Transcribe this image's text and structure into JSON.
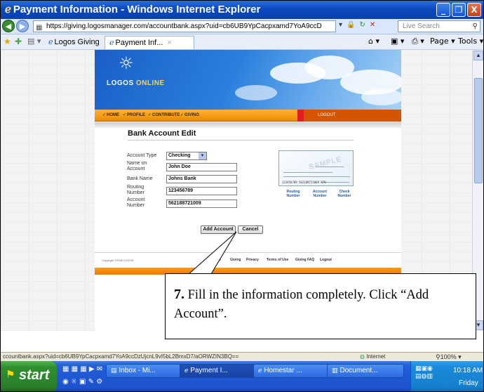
{
  "window": {
    "title": "Payment Information - Windows Internet Explorer",
    "minimize_glyph": "_",
    "restore_glyph": "❐",
    "close_glyph": "X"
  },
  "address_bar": {
    "url": "https://giving.logosmanager.com/accountbank.aspx?uid=cb6UB9YpCacpxamd7YoA9ccD",
    "search_placeholder": "Live Search"
  },
  "tabs": {
    "favorites_group_label": "Logos Giving",
    "active_tab_label": "Payment Inf...",
    "commands": [
      "Page ▾",
      "Tools ▾"
    ]
  },
  "site": {
    "logo_word": "LOGOS",
    "logo_online": "ONLINE",
    "menu": [
      "HOME",
      "PROFILE",
      "CONTRIBUTE",
      "GIVING"
    ],
    "logout_label": "LOGOUT",
    "section_title": "Bank Account Edit",
    "form": {
      "account_type_label": "Account Type",
      "account_type_value": "Checking",
      "name_label": "Name on Account",
      "name_value": "John Doe",
      "bank_label": "Bank Name",
      "bank_value": "Johns Bank",
      "routing_label": "Routing Number",
      "routing_value": "123456789",
      "account_label": "Account Number",
      "account_value": "562188721009"
    },
    "check_sample": {
      "watermark": "SAMPLE",
      "micr": "123456789  562188721009  678",
      "labels": [
        "Routing Number",
        "Account Number",
        "Check Number"
      ]
    },
    "buttons": {
      "add_account": "Add Account",
      "cancel": "Cancel"
    },
    "footer": {
      "copyright": "Copyright ©2006 LOGOS",
      "links": [
        "ribute",
        "Giving",
        "Privacy",
        "Terms of Use",
        "Giving FAQ",
        "Logout"
      ]
    }
  },
  "callout": {
    "step_number": "7.",
    "text": "Fill in the information completely.  Click “Add Account”."
  },
  "status_bar": {
    "url": "ccountbank.aspx?uid=cb6UB9YpCacpxamd7YoA9ccDzUjcnL9vI5bL2BmxD7/aORWZIN3BQ==",
    "zone": "Internet",
    "zoom": "100%"
  },
  "taskbar": {
    "start_label": "start",
    "tasks": [
      "Inbox - Mi...",
      "Payment I...",
      "Homestar ...",
      "Document..."
    ],
    "time": "10:18 AM",
    "day": "Friday"
  }
}
